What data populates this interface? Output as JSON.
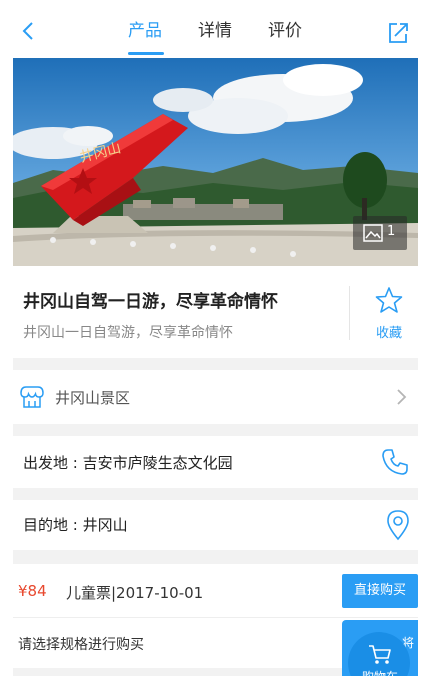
{
  "header": {
    "tabs": [
      {
        "label": "产品",
        "active": true
      },
      {
        "label": "详情",
        "active": false
      },
      {
        "label": "评价",
        "active": false
      }
    ],
    "icons": {
      "back": "chevron-left-icon",
      "share": "share-icon"
    }
  },
  "hero": {
    "gallery_count": "1",
    "sculpture_text": "井冈山"
  },
  "product": {
    "title": "井冈山自驾一日游，尽享革命情怀",
    "subtitle": "井冈山一日自驾游，尽享革命情怀",
    "favorite_label": "收藏"
  },
  "scenic": {
    "label": "井冈山景区"
  },
  "departure": {
    "text": "出发地 : 吉安市庐陵生态文化园"
  },
  "destination": {
    "text": "目的地 : 井冈山"
  },
  "ticket": {
    "price": "¥84",
    "spec": "儿童票|2017-10-01",
    "buy_label": "直接购买"
  },
  "select_spec": {
    "text": "请选择规格进行购买",
    "cart_label": "购物车",
    "cart_edge": "将"
  },
  "colors": {
    "accent": "#2a9df4",
    "price": "#e8482e",
    "gap": "#f2f2f2"
  }
}
